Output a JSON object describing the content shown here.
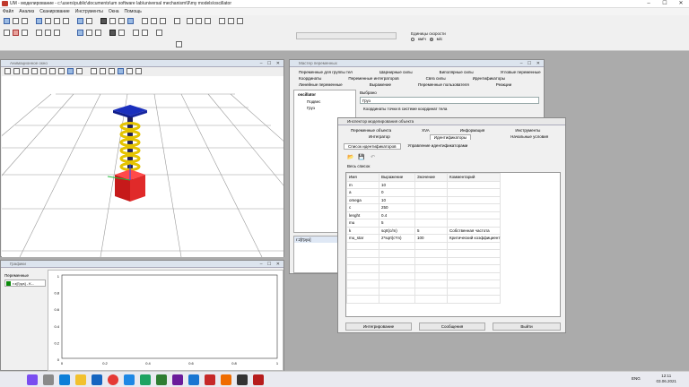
{
  "title": "UM - моделирование - c:\\users\\public\\documents\\um software lab\\universal mechanism\\9\\my models\\oscillator",
  "window_controls": [
    "–",
    "☐",
    "✕"
  ],
  "menu": [
    "Файл",
    "Анализ",
    "Сканирование",
    "Инструменты",
    "Окна",
    "Помощь"
  ],
  "speed": {
    "label": "Единицы скорости",
    "option_kmh": "км/ч",
    "option_ms": "м/с"
  },
  "view3d": {
    "title": "Анимационное окно"
  },
  "graph": {
    "title": "Графики",
    "vars_label": "Переменные",
    "legend_item": "r:z[Груз] - K...",
    "y_ticks": [
      "1",
      "0.8",
      "0.6",
      "0.4",
      "0.2",
      "0"
    ],
    "x_ticks": [
      "0",
      "0.2",
      "0.4",
      "0.6",
      "0.8",
      "1"
    ]
  },
  "vars": {
    "title": "Мастер переменных",
    "tabs_row1": [
      "Переменные для группы тел",
      "Шарнирные силы",
      "Биполярные силы",
      "Угловые переменные"
    ],
    "tabs_row2": [
      "Координаты",
      "Переменные интеграторов",
      "Связ силы",
      "Идентификаторы"
    ],
    "tabs_row3": [
      "Линейные переменные",
      "Выражение",
      "Переменные пользователя",
      "Реакции"
    ],
    "tree_root": "oscillator",
    "tree_items": [
      "Подвес",
      "Груз"
    ],
    "selected_label": "Выбрано",
    "selected_value": "Груз",
    "coords_label": "Координаты точки в системе координат тела",
    "var_item": "r:z[Груз]"
  },
  "inspector": {
    "title": "Инспектор моделирования объекта",
    "tabs_row1": [
      "Переменные объекта",
      "XVA",
      "Информация",
      "Инструменты"
    ],
    "tabs_row2": [
      "Интегратор",
      "Идентификаторы",
      "Начальные условия"
    ],
    "subtabs": [
      "Список идентификаторов",
      "Управление идентификаторами"
    ],
    "whole_list": "Весь список",
    "columns": [
      "Имя",
      "Выражение",
      "Значение",
      "Комментарий"
    ],
    "rows": [
      [
        "m",
        "10",
        "",
        ""
      ],
      [
        "a",
        "0",
        "",
        ""
      ],
      [
        "omega",
        "10",
        "",
        ""
      ],
      [
        "c",
        "250",
        "",
        ""
      ],
      [
        "lenght",
        "0.4",
        "",
        ""
      ],
      [
        "mu",
        "5",
        "",
        ""
      ],
      [
        "k",
        "sqrt(c/m)",
        "5",
        "Собственная частота"
      ],
      [
        "mu_star",
        "2*sqrt(c*m)",
        "100",
        "Критический коэффициент"
      ]
    ],
    "buttons": [
      "Интегрирование",
      "Сообщения",
      "Выйти"
    ]
  },
  "taskbar": {
    "lang": "ENG",
    "time": "12:11",
    "date": "03.06.2021"
  }
}
